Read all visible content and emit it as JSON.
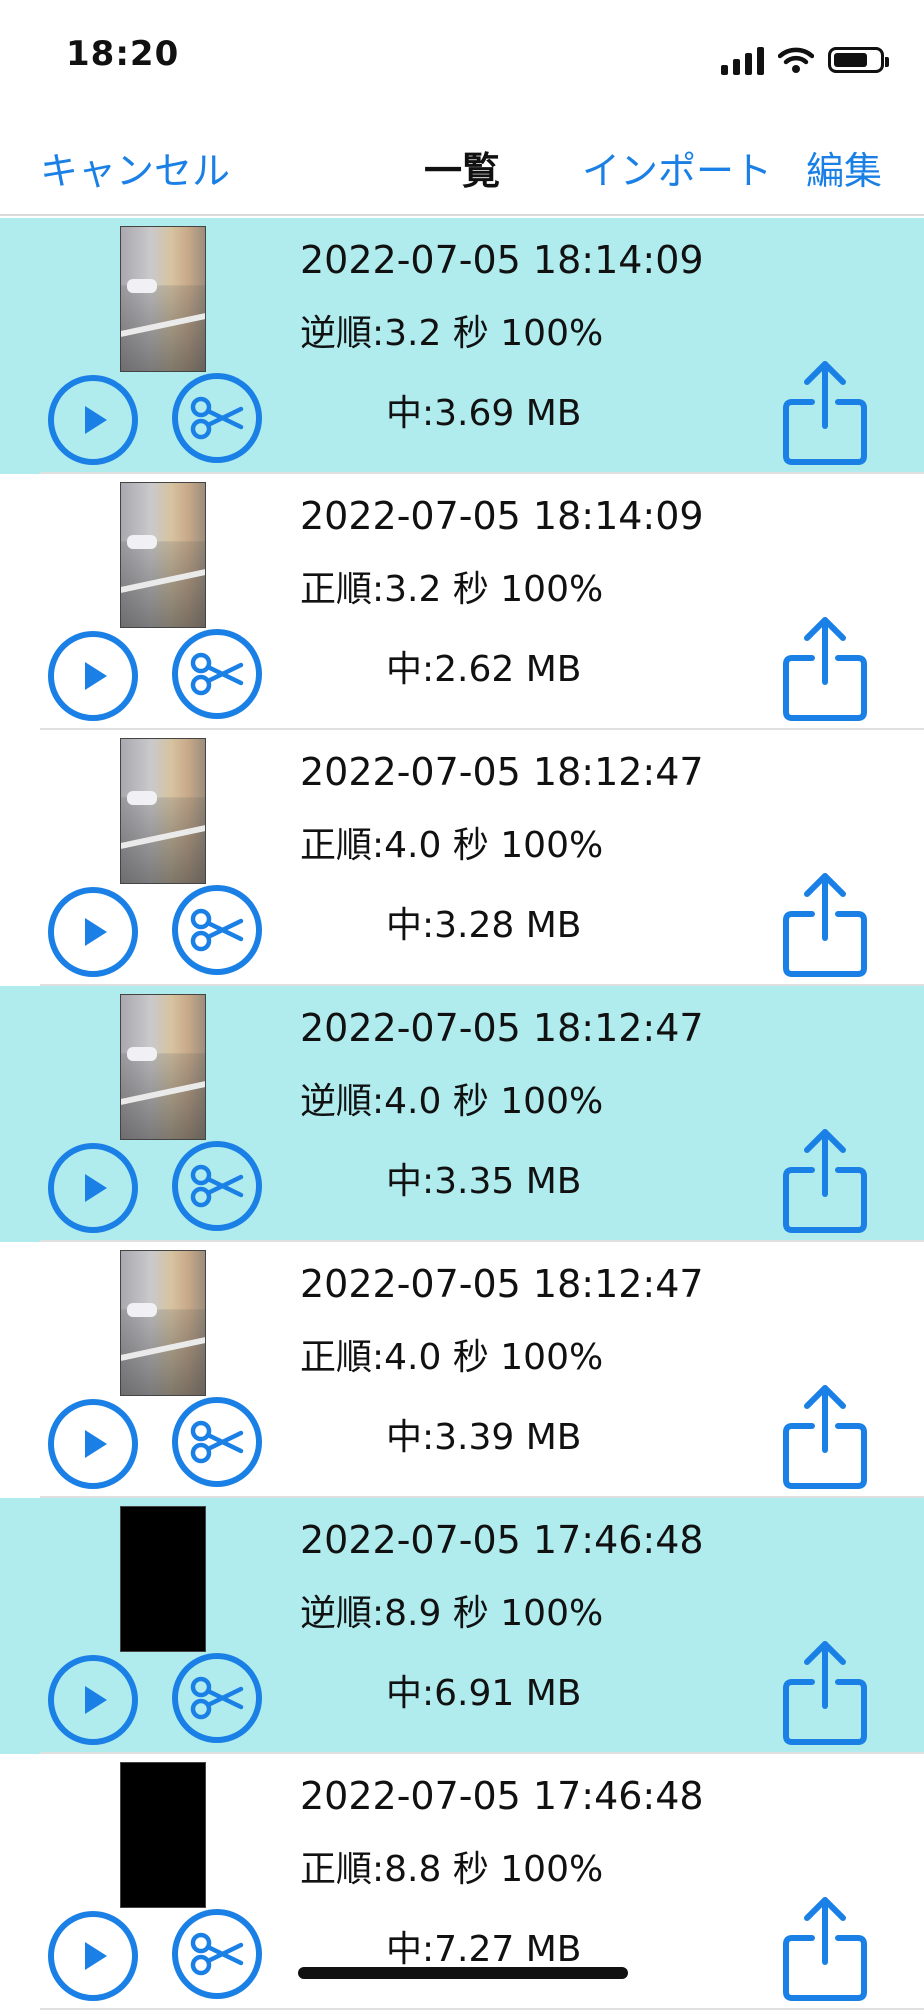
{
  "status_bar": {
    "time": "18:20",
    "battery_level_percent": 75
  },
  "nav": {
    "cancel_label": "キャンセル",
    "title": "一覧",
    "import_label": "インポート",
    "edit_label": "編集"
  },
  "colors": {
    "accent": "#1a80e6",
    "highlight_row": "#b0ecee"
  },
  "icons": {
    "play": "play-icon",
    "cut": "scissors-icon",
    "share": "share-icon"
  },
  "rows": [
    {
      "date": "2022-07-05 18:14:09",
      "info": "逆順:3.2 秒 100%",
      "size": "中:3.69 MB",
      "highlighted": true,
      "thumbnail": "photo"
    },
    {
      "date": "2022-07-05 18:14:09",
      "info": "正順:3.2 秒 100%",
      "size": "中:2.62 MB",
      "highlighted": false,
      "thumbnail": "photo"
    },
    {
      "date": "2022-07-05 18:12:47",
      "info": "正順:4.0 秒 100%",
      "size": "中:3.28 MB",
      "highlighted": false,
      "thumbnail": "photo"
    },
    {
      "date": "2022-07-05 18:12:47",
      "info": "逆順:4.0 秒 100%",
      "size": "中:3.35 MB",
      "highlighted": true,
      "thumbnail": "photo"
    },
    {
      "date": "2022-07-05 18:12:47",
      "info": "正順:4.0 秒 100%",
      "size": "中:3.39 MB",
      "highlighted": false,
      "thumbnail": "photo"
    },
    {
      "date": "2022-07-05 17:46:48",
      "info": "逆順:8.9 秒 100%",
      "size": "中:6.91 MB",
      "highlighted": true,
      "thumbnail": "black"
    },
    {
      "date": "2022-07-05 17:46:48",
      "info": "正順:8.8 秒 100%",
      "size": "中:7.27 MB",
      "highlighted": false,
      "thumbnail": "black"
    }
  ]
}
